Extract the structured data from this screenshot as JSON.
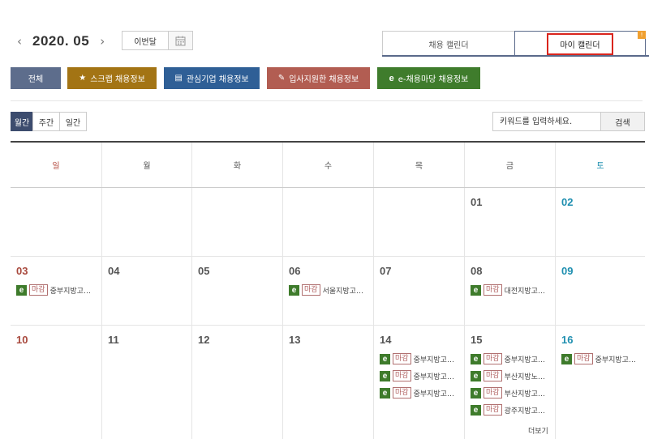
{
  "nav": {
    "prev_icon": "‹",
    "month": "2020. 05",
    "next_icon": "›",
    "this_month": "이번달",
    "calendar_icon": "calendar-icon"
  },
  "tabs": {
    "recruit": "채용 캘린더",
    "my": "마이 캘린더",
    "badge": "!"
  },
  "filters": {
    "all": "전체",
    "scrap": "스크랩 채용정보",
    "interest": "관심기업 채용정보",
    "applied": "입사지원한 채용정보",
    "emadang": "e-채용마당 채용정보",
    "star_icon": "★",
    "building_icon": "▤",
    "pen_icon": "✎",
    "e_icon": "e"
  },
  "views": {
    "monthly": "월간",
    "weekly": "주간",
    "daily": "일간"
  },
  "search": {
    "placeholder": "키워드를 입력하세요.",
    "button": "검색"
  },
  "calendar": {
    "weekdays": [
      "일",
      "월",
      "화",
      "수",
      "목",
      "금",
      "토"
    ],
    "e_mark": "e",
    "deadline": "마감",
    "more": "더보기",
    "weeks": [
      {
        "days": [
          "",
          "",
          "",
          "",
          "",
          "01",
          "02"
        ]
      },
      {
        "days": [
          "03",
          "04",
          "05",
          "06",
          "07",
          "08",
          "09"
        ],
        "events": {
          "0": [
            "중부지방고…"
          ],
          "3": [
            "서울지방고…"
          ],
          "5": [
            "대전지방고…"
          ]
        }
      },
      {
        "days": [
          "10",
          "11",
          "12",
          "13",
          "14",
          "15",
          "16"
        ],
        "events": {
          "4": [
            "중부지방고…",
            "중부지방고…",
            "중부지방고…"
          ],
          "5": [
            "중부지방고…",
            "부산지방노…",
            "부산지방고…",
            "광주지방고…"
          ],
          "6": [
            "중부지방고…"
          ]
        }
      }
    ]
  },
  "colors": {
    "accent": "#5d6d8c",
    "highlight_border": "#d9251d",
    "e_green": "#3e7b2b"
  }
}
